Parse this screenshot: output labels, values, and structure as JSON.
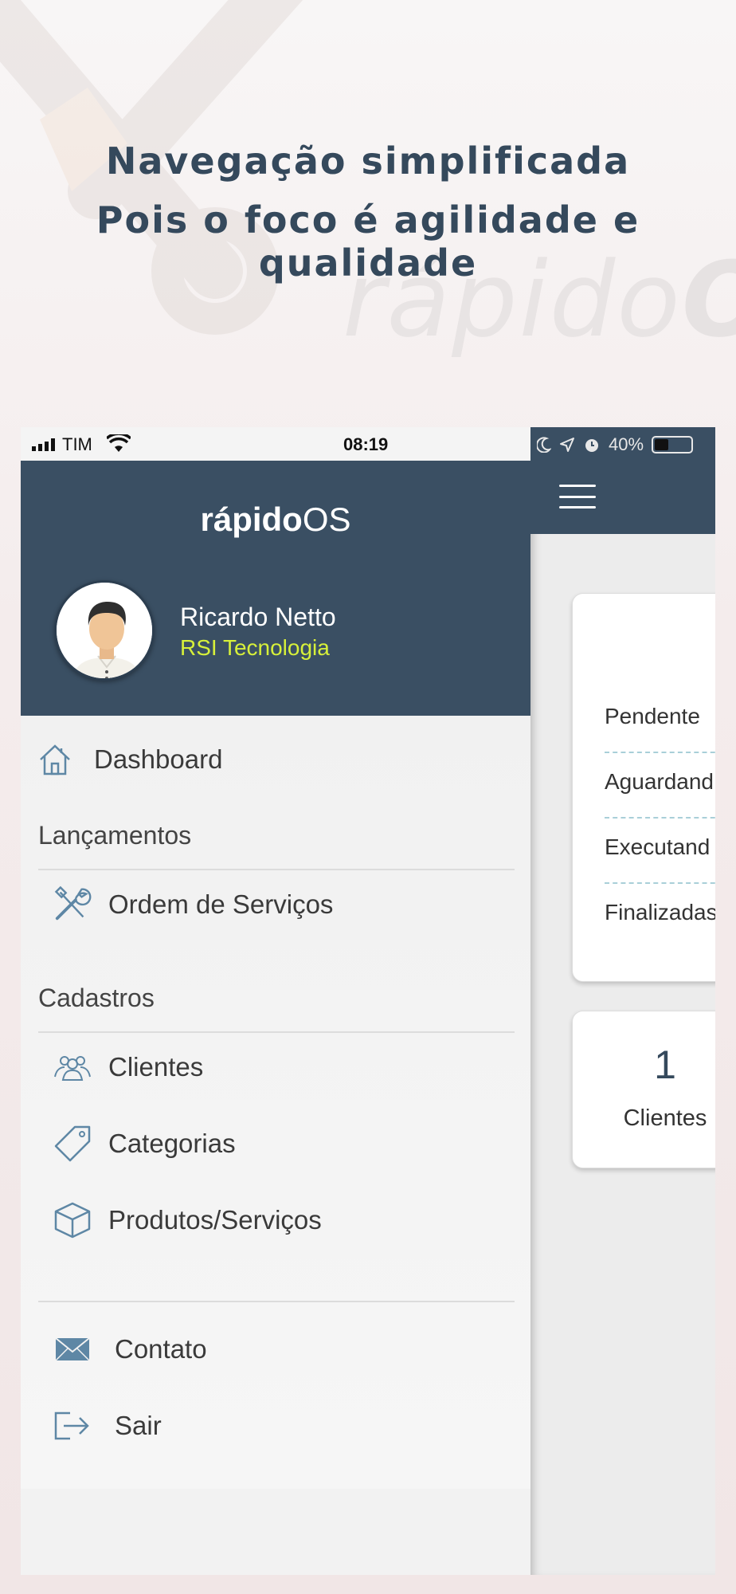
{
  "headline": {
    "line1": "Navegação simplificada",
    "line2": "Pois o foco é agilidade e qualidade"
  },
  "background": {
    "wordmark": "rápido",
    "wordmark_o": "O"
  },
  "status_bar": {
    "carrier": "TIM",
    "time": "08:19",
    "battery": "40%",
    "battery_level": 0.4
  },
  "drawer": {
    "brand_bold": "rápido",
    "brand_light": "OS",
    "user_name": "Ricardo Netto",
    "company": "RSI Tecnologia",
    "dashboard": "Dashboard",
    "section_lancamentos": "Lançamentos",
    "ordem_servicos": "Ordem de Serviços",
    "section_cadastros": "Cadastros",
    "clientes": "Clientes",
    "categorias": "Categorias",
    "produtos_servicos": "Produtos/Serviços",
    "contato": "Contato",
    "sair": "Sair"
  },
  "main": {
    "status_list": [
      "Pendente",
      "Aguardand",
      "Executand",
      "Finalizadas"
    ],
    "clients_count": "1",
    "clients_label": "Clientes"
  },
  "colors": {
    "primary": "#3a4f63",
    "accent": "#d7f03a",
    "headline": "#35495c"
  },
  "icons": {
    "dashboard": "home-icon",
    "ordem_servicos": "tools-icon",
    "clientes": "users-icon",
    "categorias": "tag-icon",
    "produtos_servicos": "box-icon",
    "contato": "mail-icon",
    "sair": "logout-icon"
  }
}
